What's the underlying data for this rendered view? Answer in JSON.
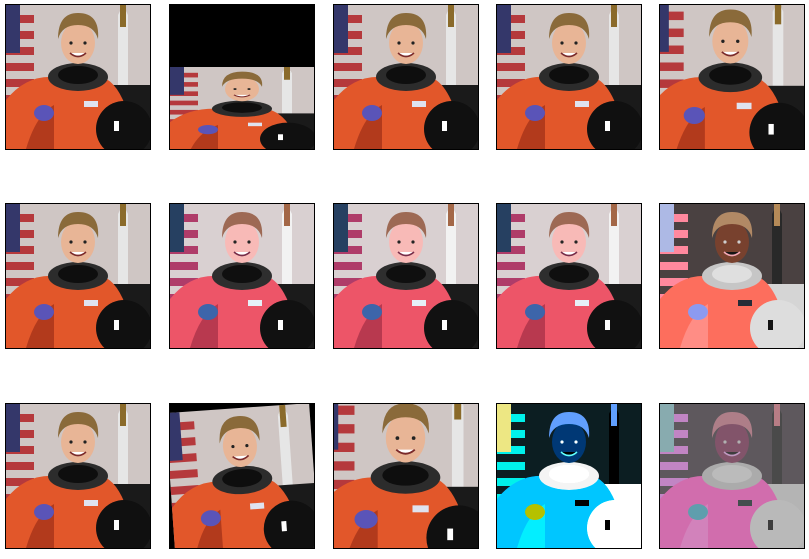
{
  "figure": {
    "panels": [
      {
        "variant": "original"
      },
      {
        "variant": "shifted-down"
      },
      {
        "variant": "original"
      },
      {
        "variant": "original"
      },
      {
        "variant": "slight-zoom"
      },
      {
        "variant": "original"
      },
      {
        "variant": "cool-tint"
      },
      {
        "variant": "cool-tint"
      },
      {
        "variant": "cool-tint"
      },
      {
        "variant": "inverted-soft"
      },
      {
        "variant": "original"
      },
      {
        "variant": "rotated-slight"
      },
      {
        "variant": "zoomed"
      },
      {
        "variant": "inverted-high-contrast"
      },
      {
        "variant": "solarized-noise"
      }
    ],
    "colors": {
      "suit": "#e2572a",
      "suit_shadow": "#b23a1c",
      "skin": "#e8b596",
      "hair": "#8a6a3a",
      "background": "#cfc6c4",
      "flag_red": "#b5393c",
      "flag_blue": "#34376a",
      "helmet": "#101010",
      "patch": "#5a54b8",
      "shuttle": "#e6e6e6"
    }
  }
}
